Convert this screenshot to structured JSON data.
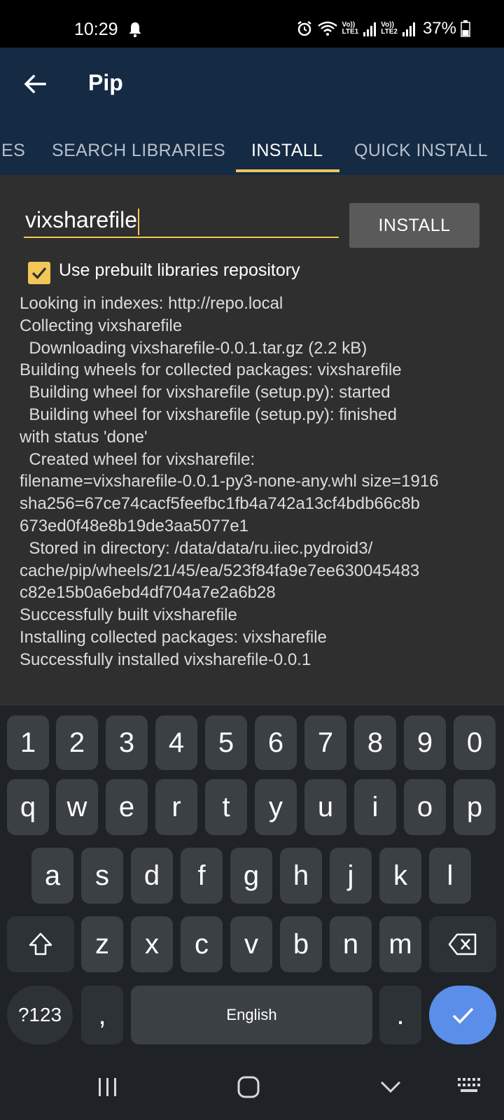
{
  "status_bar": {
    "time": "10:29",
    "sim1_label_top": "Vo))",
    "sim1_label_bottom": "LTE1",
    "sim2_label_top": "Vo))",
    "sim2_label_bottom": "LTE2",
    "battery_percent": "37%",
    "icons": [
      "bell-icon",
      "alarm-icon",
      "wifi-icon",
      "signal-icon",
      "battery-icon"
    ]
  },
  "app_bar": {
    "title": "Pip",
    "tabs": [
      {
        "label": "ES"
      },
      {
        "label": "SEARCH LIBRARIES"
      },
      {
        "label": "INSTALL"
      },
      {
        "label": "QUICK INSTALL"
      }
    ],
    "active_tab": "INSTALL",
    "accent_color": "#f2c757",
    "bar_color": "#152a43"
  },
  "install_form": {
    "package_value": "vixsharefile",
    "install_label": "INSTALL",
    "checkbox_label": "Use prebuilt libraries repository",
    "checkbox_checked": true
  },
  "log": [
    "Looking in indexes: http://repo.local",
    "Collecting vixsharefile",
    "  Downloading vixsharefile-0.0.1.tar.gz (2.2 kB)",
    "Building wheels for collected packages: vixsharefile",
    "  Building wheel for vixsharefile (setup.py): started",
    "  Building wheel for vixsharefile (setup.py): finished",
    "with status 'done'",
    "  Created wheel for vixsharefile:",
    "filename=vixsharefile-0.0.1-py3-none-any.whl size=1916",
    "sha256=67ce74cacf5feefbc1fb4a742a13cf4bdb66c8b",
    "673ed0f48e8b19de3aa5077e1",
    "  Stored in directory: /data/data/ru.iiec.pydroid3/",
    "cache/pip/wheels/21/45/ea/523f84fa9e7ee630045483",
    "c82e15b0a6ebd4df704a7e2a6b28",
    "Successfully built vixsharefile",
    "Installing collected packages: vixsharefile",
    "Successfully installed vixsharefile-0.0.1"
  ],
  "keyboard": {
    "row_numbers": [
      "1",
      "2",
      "3",
      "4",
      "5",
      "6",
      "7",
      "8",
      "9",
      "0"
    ],
    "row_1": [
      "q",
      "w",
      "e",
      "r",
      "t",
      "y",
      "u",
      "i",
      "o",
      "p"
    ],
    "row_2": [
      "a",
      "s",
      "d",
      "f",
      "g",
      "h",
      "j",
      "k",
      "l"
    ],
    "row_3": [
      "z",
      "x",
      "c",
      "v",
      "b",
      "n",
      "m"
    ],
    "symbols_label": "?123",
    "comma": ",",
    "space_label": "English",
    "period": ".",
    "enter_color": "#5a8ee8"
  },
  "nav_bar": {
    "icons": [
      "recents-icon",
      "home-icon",
      "back-down-icon",
      "keyboard-icon"
    ]
  }
}
